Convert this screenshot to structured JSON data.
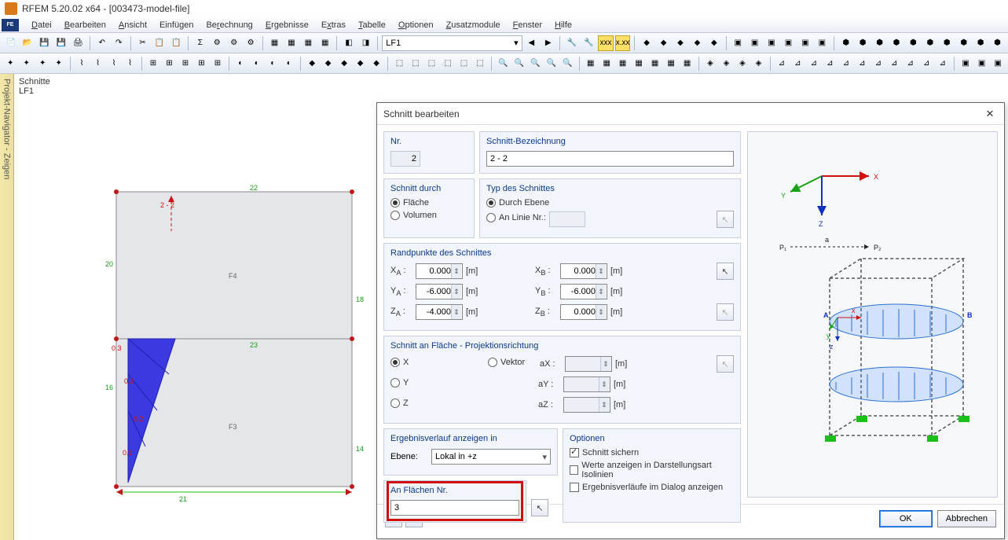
{
  "title": "RFEM 5.20.02 x64 - [003473-model-file]",
  "menus": [
    "Datei",
    "Bearbeiten",
    "Ansicht",
    "Einfügen",
    "Berechnung",
    "Ergebnisse",
    "Extras",
    "Tabelle",
    "Optionen",
    "Zusatzmodule",
    "Fenster",
    "Hilfe"
  ],
  "loadcase_combo": "LF1",
  "sidetab": "Projekt-Navigator - Zeigen",
  "viewport_label1": "Schnitte",
  "viewport_label2": "LF1",
  "dialog": {
    "title": "Schnitt bearbeiten",
    "nr_label": "Nr.",
    "nr_value": "2",
    "name_label": "Schnitt-Bezeichnung",
    "name_value": "2 - 2",
    "through_label": "Schnitt durch",
    "through_opts": {
      "flaeche": "Fläche",
      "volumen": "Volumen"
    },
    "type_label": "Typ des Schnittes",
    "type_opts": {
      "ebene": "Durch Ebene",
      "linie": "An Linie Nr.:"
    },
    "randpunkte_label": "Randpunkte des Schnittes",
    "xa_label": "X",
    "xa_sub": "A",
    "xa_val": "0.000",
    "xb_label": "X",
    "xb_sub": "B",
    "xb_val": "0.000",
    "ya_label": "Y",
    "ya_sub": "A",
    "ya_val": "-6.000",
    "yb_label": "Y",
    "yb_sub": "B",
    "yb_val": "-6.000",
    "za_label": "Z",
    "za_sub": "A",
    "za_val": "-4.000",
    "zb_label": "Z",
    "zb_sub": "B",
    "zb_val": "0.000",
    "unit_m": "[m]",
    "colon": " :",
    "proj_label": "Schnitt an Fläche - Projektionsrichtung",
    "proj_opts": {
      "x": "X",
      "y": "Y",
      "z": "Z",
      "vektor": "Vektor"
    },
    "ax_label": "aX :",
    "ay_label": "aY :",
    "az_label": "aZ :",
    "result_label": "Ergebnisverlauf anzeigen in",
    "result_plane_label": "Ebene:",
    "result_plane_value": "Lokal in +z",
    "flaechen_label": "An Flächen Nr.",
    "flaechen_value": "3",
    "options_label": "Optionen",
    "opt_sichern": "Schnitt sichern",
    "opt_werte": "Werte anzeigen in Darstellungsart Isolinien",
    "opt_verlaufe": "Ergebnisverläufe im Dialog anzeigen",
    "ok": "OK",
    "cancel": "Abbrechen"
  },
  "drawing": {
    "edge_top": "22",
    "edge_right_upper": "18",
    "edge_right_lower": "14",
    "edge_left_upper": "20",
    "edge_left_lower": "16",
    "edge_bottom": "21",
    "edge_mid": "23",
    "surf_top": "F4",
    "surf_bot": "F3",
    "section_lbl": "2 - 2",
    "v03": "0.3",
    "v02a": "0.2",
    "v02b": "0.2",
    "v01": "0.1"
  }
}
